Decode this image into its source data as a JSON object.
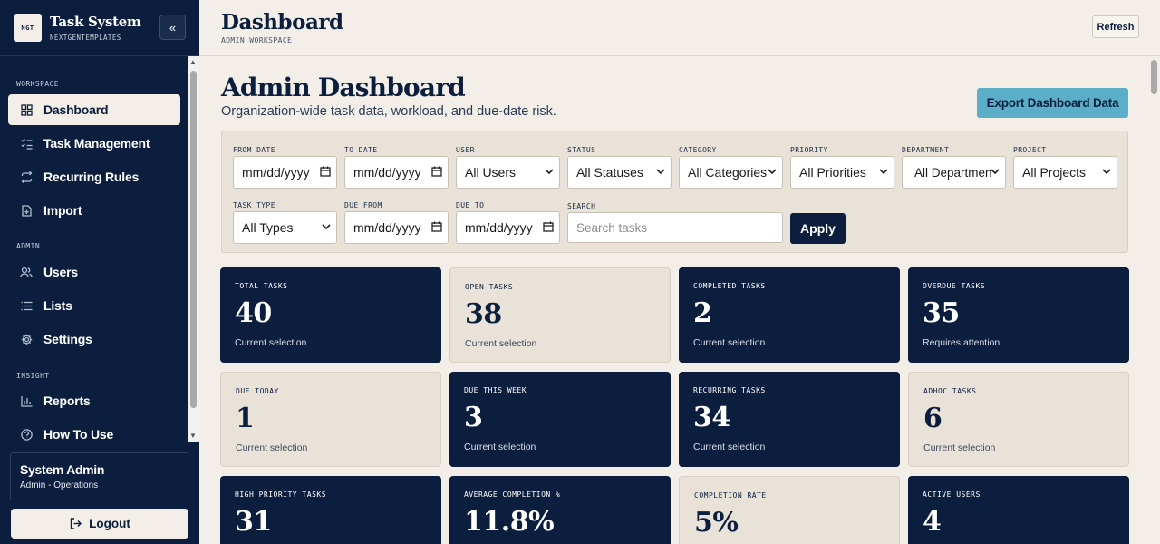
{
  "app": {
    "logo_text": "NGT",
    "title": "Task System",
    "subtitle": "NEXTGENTEMPLATES",
    "collapse_icon": "chevrons-left-icon"
  },
  "sidebar": {
    "sections": [
      {
        "label": "WORKSPACE"
      },
      {
        "label": "ADMIN"
      },
      {
        "label": "INSIGHT"
      }
    ],
    "items": [
      {
        "label": "Dashboard",
        "icon": "grid-icon",
        "active": true
      },
      {
        "label": "Task Management",
        "icon": "checklist-icon"
      },
      {
        "label": "Recurring Rules",
        "icon": "repeat-icon"
      },
      {
        "label": "Import",
        "icon": "file-import-icon"
      },
      {
        "label": "Users",
        "icon": "users-icon"
      },
      {
        "label": "Lists",
        "icon": "list-icon"
      },
      {
        "label": "Settings",
        "icon": "gear-icon"
      },
      {
        "label": "Reports",
        "icon": "bar-chart-icon"
      },
      {
        "label": "How To Use",
        "icon": "help-circle-icon"
      }
    ],
    "user": {
      "name": "System Admin",
      "role": "Admin - Operations"
    },
    "logout_label": "Logout"
  },
  "header": {
    "title": "Dashboard",
    "subtitle": "ADMIN WORKSPACE",
    "refresh_label": "Refresh"
  },
  "main": {
    "title": "Admin Dashboard",
    "subtitle": "Organization-wide task data, workload, and due-date risk.",
    "export_label": "Export Dashboard Data"
  },
  "filters": {
    "from_date": {
      "label": "FROM DATE",
      "value": "mm/dd/yyyy"
    },
    "to_date": {
      "label": "TO DATE",
      "value": "mm/dd/yyyy"
    },
    "user": {
      "label": "USER",
      "value": "All Users"
    },
    "status": {
      "label": "STATUS",
      "value": "All Statuses"
    },
    "category": {
      "label": "CATEGORY",
      "value": "All Categories"
    },
    "priority": {
      "label": "PRIORITY",
      "value": "All Priorities"
    },
    "department": {
      "label": "DEPARTMENT",
      "value": "All Departments"
    },
    "project": {
      "label": "PROJECT",
      "value": "All Projects"
    },
    "task_type": {
      "label": "TASK TYPE",
      "value": "All Types"
    },
    "due_from": {
      "label": "DUE FROM",
      "value": "mm/dd/yyyy"
    },
    "due_to": {
      "label": "DUE TO",
      "value": "mm/dd/yyyy"
    },
    "search": {
      "label": "SEARCH",
      "placeholder": "Search tasks"
    },
    "apply_label": "Apply"
  },
  "stats": [
    {
      "label": "TOTAL TASKS",
      "value": "40",
      "note": "Current selection",
      "theme": "dark"
    },
    {
      "label": "OPEN TASKS",
      "value": "38",
      "note": "Current selection",
      "theme": "light"
    },
    {
      "label": "COMPLETED TASKS",
      "value": "2",
      "note": "Current selection",
      "theme": "dark"
    },
    {
      "label": "OVERDUE TASKS",
      "value": "35",
      "note": "Requires attention",
      "theme": "dark"
    },
    {
      "label": "DUE TODAY",
      "value": "1",
      "note": "Current selection",
      "theme": "light"
    },
    {
      "label": "DUE THIS WEEK",
      "value": "3",
      "note": "Current selection",
      "theme": "dark"
    },
    {
      "label": "RECURRING TASKS",
      "value": "34",
      "note": "Current selection",
      "theme": "dark"
    },
    {
      "label": "ADHOC TASKS",
      "value": "6",
      "note": "Current selection",
      "theme": "light"
    },
    {
      "label": "HIGH PRIORITY TASKS",
      "value": "31",
      "note": "",
      "theme": "dark"
    },
    {
      "label": "AVERAGE COMPLETION %",
      "value": "11.8%",
      "note": "",
      "theme": "dark"
    },
    {
      "label": "COMPLETION RATE",
      "value": "5%",
      "note": "",
      "theme": "light"
    },
    {
      "label": "ACTIVE USERS",
      "value": "4",
      "note": "",
      "theme": "dark"
    }
  ],
  "colors": {
    "navy": "#0c1e3d",
    "cream": "#f3efe8",
    "panel": "#e8e2d8",
    "accent": "#5aaec7"
  }
}
